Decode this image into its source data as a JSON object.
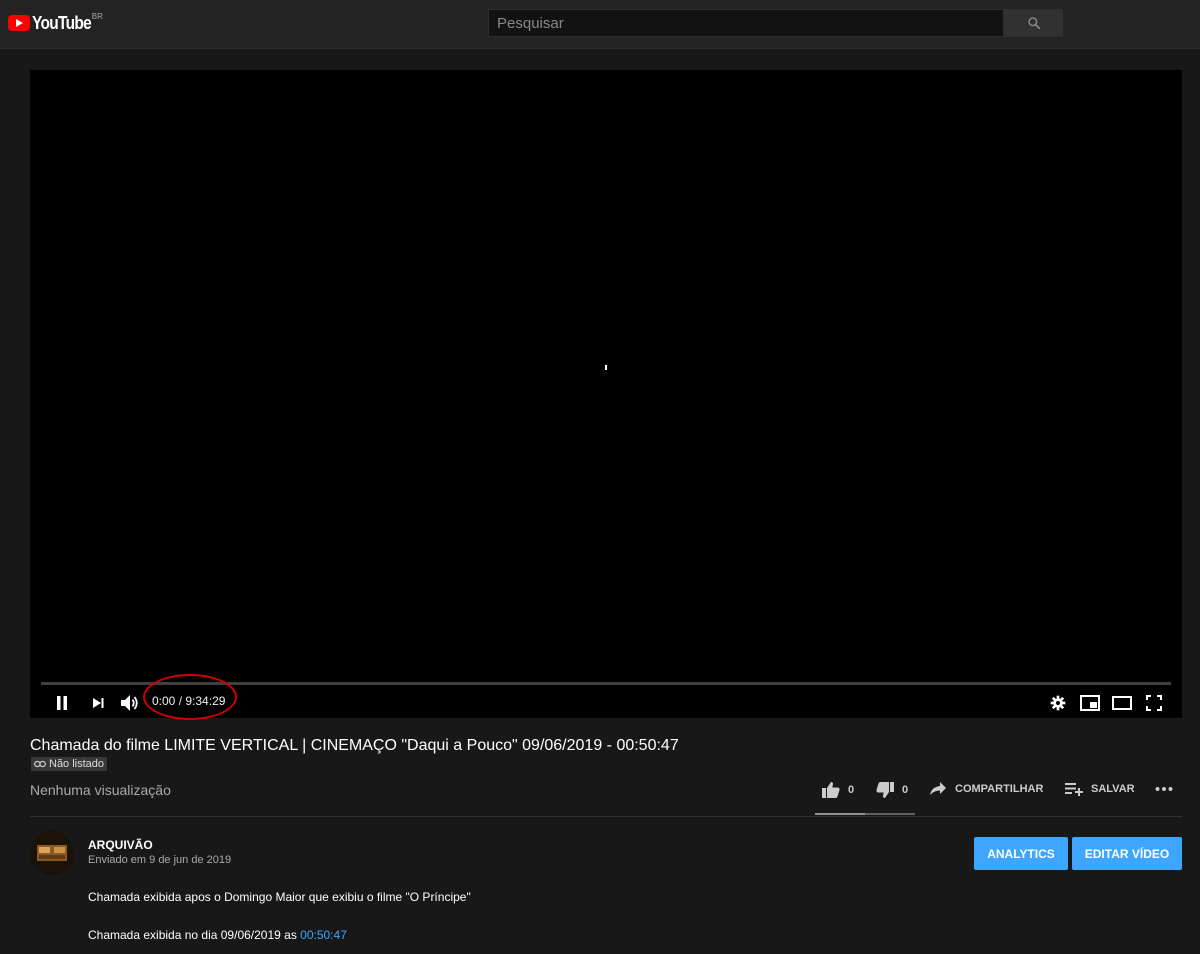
{
  "header": {
    "logo_text": "YouTube",
    "region": "BR",
    "search_placeholder": "Pesquisar"
  },
  "player": {
    "time_current": "0:00",
    "time_total": "9:34:29",
    "progress": 0
  },
  "video": {
    "title": "Chamada do filme LIMITE VERTICAL | CINEMAÇO \"Daqui a Pouco\" 09/06/2019 - 00:50:47",
    "privacy_badge": "Não listado",
    "views": "Nenhuma visualização",
    "likes": "0",
    "dislikes": "0",
    "share_label": "COMPARTILHAR",
    "save_label": "SALVAR"
  },
  "channel": {
    "name": "ARQUIVÃO",
    "published": "Enviado em 9 de jun de 2019",
    "analytics_label": "ANALYTICS",
    "edit_label": "EDITAR VÍDEO"
  },
  "description": {
    "line1": "Chamada exibida apos o Domingo Maior que exibiu o filme \"O Príncipe\"",
    "line2_text": "Chamada exibida no dia 09/06/2019 as ",
    "line2_link": "00:50:47"
  },
  "colors": {
    "accent": "#3ea6ff",
    "brand": "#ff0000",
    "annotation": "#d10000"
  }
}
